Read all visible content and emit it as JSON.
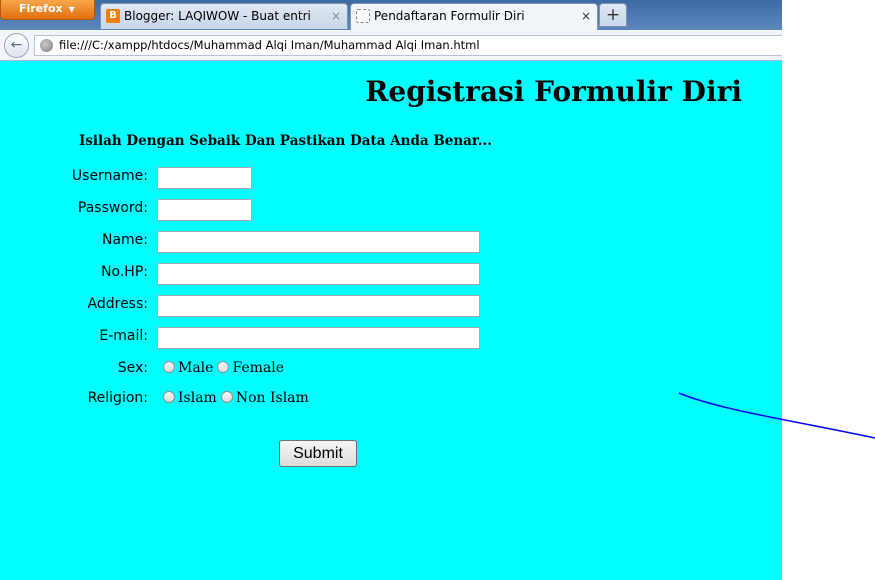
{
  "browser": {
    "menu_button": "Firefox",
    "tabs": [
      {
        "title": "Blogger: LAQIWOW - Buat entri",
        "favicon": "blogger-icon",
        "active": false
      },
      {
        "title": "Pendaftaran Formulir Diri",
        "favicon": "blank-page-icon",
        "active": true
      }
    ],
    "new_tab_symbol": "+",
    "close_symbol": "×",
    "back_symbol": "←",
    "address": "file:///C:/xampp/htdocs/Muhammad Alqi Iman/Muhammad Alqi Iman.html"
  },
  "page": {
    "background_color": "#00ffff",
    "title": "Registrasi Formulir Diri",
    "instruction": "Isilah Dengan Sebaik Dan Pastikan Data Anda Benar...",
    "fields": {
      "username_label": "Username:",
      "password_label": "Password:",
      "name_label": "Name:",
      "phone_label": "No.HP:",
      "address_label": "Address:",
      "email_label": "E-mail:"
    },
    "sex": {
      "label": "Sex:",
      "options": [
        "Male",
        "Female"
      ]
    },
    "religion": {
      "label": "Religion:",
      "options": [
        "Islam",
        "Non Islam"
      ]
    },
    "submit_label": "Submit"
  },
  "colors": {
    "pen_stroke": "#0000ff"
  }
}
